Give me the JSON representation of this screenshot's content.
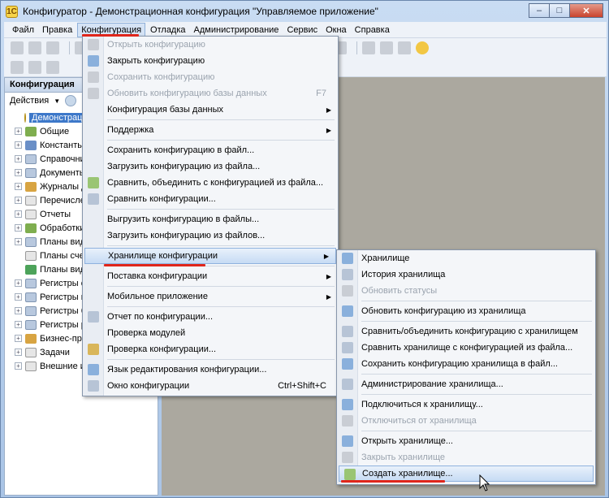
{
  "window": {
    "title": "Конфигуратор - Демонстрационная конфигурация \"Управляемое приложение\"",
    "app_icon": "1С",
    "controls": {
      "minimize": "–",
      "maximize": "□",
      "close": "✕"
    }
  },
  "menubar": {
    "items": [
      {
        "label": "Файл"
      },
      {
        "label": "Правка"
      },
      {
        "label": "Конфигурация"
      },
      {
        "label": "Отладка"
      },
      {
        "label": "Администрирование"
      },
      {
        "label": "Сервис"
      },
      {
        "label": "Окна"
      },
      {
        "label": "Справка"
      }
    ]
  },
  "left_panel": {
    "title": "Конфигурация",
    "actions_label": "Действия",
    "tree": [
      {
        "label": "Демонстрационная конфигурация",
        "root": true
      },
      {
        "label": "Общие",
        "expander": "+"
      },
      {
        "label": "Константы",
        "expander": "+"
      },
      {
        "label": "Справочники",
        "expander": "+"
      },
      {
        "label": "Документы",
        "expander": "+"
      },
      {
        "label": "Журналы документов",
        "expander": "+"
      },
      {
        "label": "Перечисления",
        "expander": "+"
      },
      {
        "label": "Отчеты",
        "expander": "+"
      },
      {
        "label": "Обработки",
        "expander": "+"
      },
      {
        "label": "Планы видов характеристик",
        "expander": "+"
      },
      {
        "label": "Планы счетов",
        "expander": ""
      },
      {
        "label": "Планы видов расчета",
        "expander": ""
      },
      {
        "label": "Регистры сведений",
        "expander": "+"
      },
      {
        "label": "Регистры накопления",
        "expander": "+"
      },
      {
        "label": "Регистры бухгалтерии",
        "expander": "+"
      },
      {
        "label": "Регистры расчета",
        "expander": "+"
      },
      {
        "label": "Бизнес-процессы",
        "expander": "+"
      },
      {
        "label": "Задачи",
        "expander": "+"
      },
      {
        "label": "Внешние источники данных",
        "expander": "+"
      }
    ]
  },
  "config_menu": {
    "items": [
      {
        "label": "Открыть конфигурацию",
        "disabled": true,
        "icon": "i5"
      },
      {
        "label": "Закрыть конфигурацию",
        "icon": "i1"
      },
      {
        "label": "Сохранить конфигурацию",
        "disabled": true,
        "icon": "i5"
      },
      {
        "label": "Обновить конфигурацию базы данных",
        "disabled": true,
        "shortcut": "F7",
        "icon": "i5"
      },
      {
        "label": "Конфигурация базы данных",
        "submenu": true
      },
      {
        "sep": true
      },
      {
        "label": "Поддержка",
        "submenu": true
      },
      {
        "sep": true
      },
      {
        "label": "Сохранить конфигурацию в файл..."
      },
      {
        "label": "Загрузить конфигурацию из файла..."
      },
      {
        "label": "Сравнить, объединить с конфигурацией из файла...",
        "icon": "i3"
      },
      {
        "label": "Сравнить конфигурации...",
        "icon": "i2"
      },
      {
        "sep": true
      },
      {
        "label": "Выгрузить конфигурацию в файлы..."
      },
      {
        "label": "Загрузить конфигурацию из файлов..."
      },
      {
        "sep": true
      },
      {
        "label": "Хранилище конфигурации",
        "submenu": true,
        "highlighted": true
      },
      {
        "sep": true
      },
      {
        "label": "Поставка конфигурации",
        "submenu": true
      },
      {
        "sep": true
      },
      {
        "label": "Мобильное приложение",
        "submenu": true
      },
      {
        "sep": true
      },
      {
        "label": "Отчет по конфигурации...",
        "icon": "i2"
      },
      {
        "label": "Проверка модулей"
      },
      {
        "label": "Проверка конфигурации...",
        "icon": "i4"
      },
      {
        "sep": true
      },
      {
        "label": "Язык редактирования конфигурации...",
        "icon": "i1"
      },
      {
        "label": "Окно конфигурации",
        "shortcut": "Ctrl+Shift+C",
        "icon": "i2"
      }
    ]
  },
  "storage_submenu": {
    "items": [
      {
        "label": "Хранилище",
        "icon": "i1"
      },
      {
        "label": "История хранилища",
        "icon": "i2"
      },
      {
        "label": "Обновить статусы",
        "disabled": true,
        "icon": "i5"
      },
      {
        "sep": true
      },
      {
        "label": "Обновить конфигурацию из хранилища",
        "icon": "i1"
      },
      {
        "sep": true
      },
      {
        "label": "Сравнить/объединить конфигурацию с хранилищем",
        "icon": "i2"
      },
      {
        "label": "Сравнить хранилище с конфигурацией из файла...",
        "icon": "i2"
      },
      {
        "label": "Сохранить конфигурацию хранилища в файл...",
        "icon": "i1"
      },
      {
        "sep": true
      },
      {
        "label": "Администрирование хранилища...",
        "icon": "i2"
      },
      {
        "sep": true
      },
      {
        "label": "Подключиться к хранилищу...",
        "icon": "i1"
      },
      {
        "label": "Отключиться от хранилища",
        "disabled": true,
        "icon": "i5"
      },
      {
        "sep": true
      },
      {
        "label": "Открыть хранилище...",
        "icon": "i1"
      },
      {
        "label": "Закрыть хранилище",
        "disabled": true,
        "icon": "i5"
      },
      {
        "label": "Создать хранилище...",
        "highlighted": true,
        "icon": "i3"
      }
    ]
  },
  "colors": {
    "annotation_red": "#e0261b",
    "highlight_blue": "#c6dbf4",
    "workspace": "#aba89f"
  }
}
